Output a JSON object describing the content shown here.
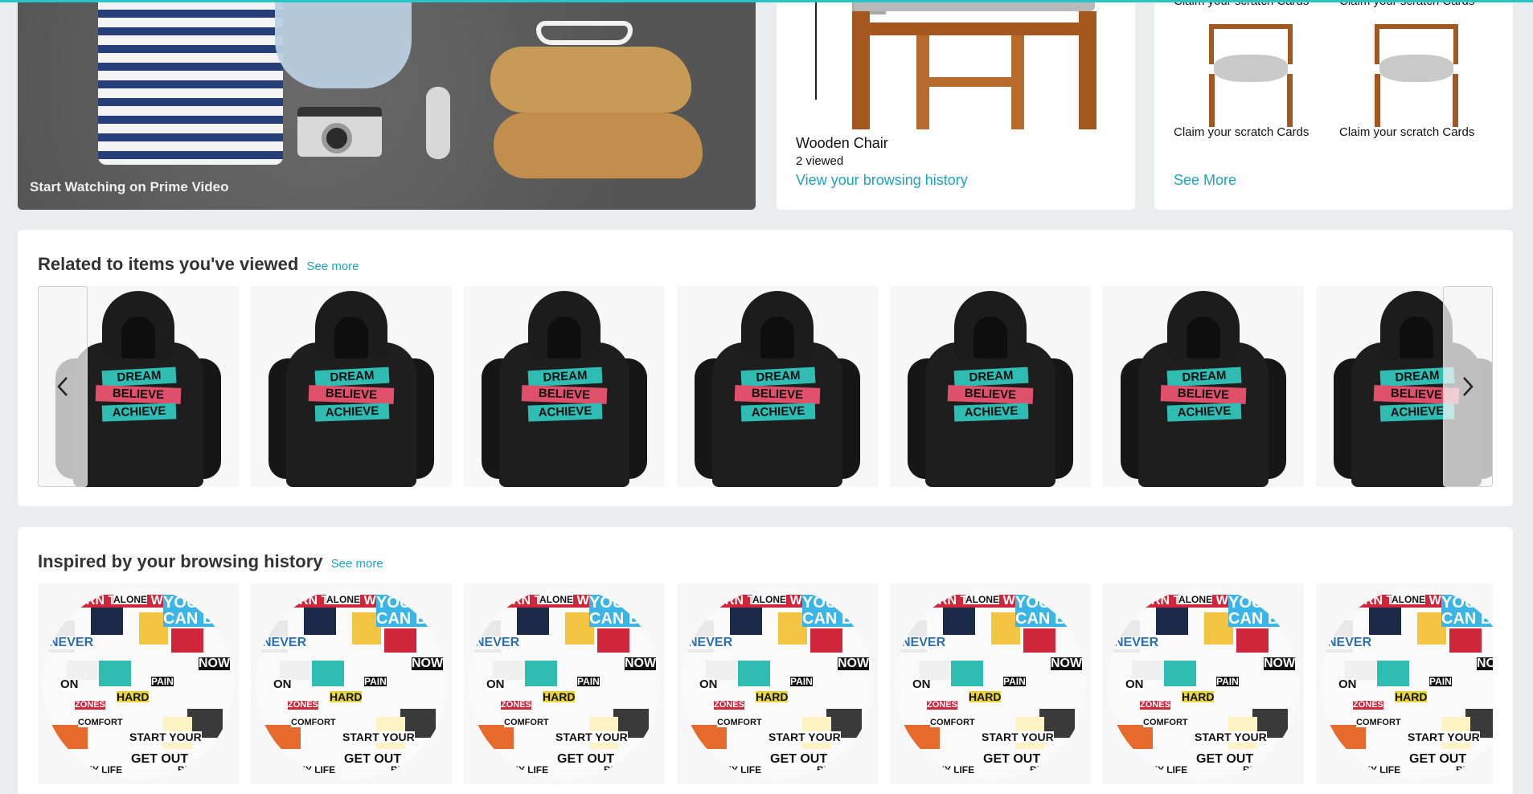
{
  "top_row": {
    "prime": {
      "label": "Start Watching on Prime Video"
    },
    "browsing": {
      "title": "Wooden Chair",
      "viewed": "2 viewed",
      "link": "View your browsing history"
    },
    "scratch": {
      "item_label": "Claim your scratch Cards",
      "see_more": "See More"
    }
  },
  "related": {
    "title": "Related to items you've viewed",
    "see_more": "See more",
    "items": [
      {
        "lines": [
          "DREAM",
          "BELIEVE",
          "ACHIEVE"
        ]
      },
      {
        "lines": [
          "DREAM",
          "BELIEVE",
          "ACHIEVE"
        ]
      },
      {
        "lines": [
          "DREAM",
          "BELIEVE",
          "ACHIEVE"
        ]
      },
      {
        "lines": [
          "DREAM",
          "BELIEVE",
          "ACHIEVE"
        ]
      },
      {
        "lines": [
          "DREAM",
          "BELIEVE",
          "ACHIEVE"
        ]
      },
      {
        "lines": [
          "DREAM",
          "BELIEVE",
          "ACHIEVE"
        ]
      },
      {
        "lines": [
          "DREAM",
          "BELIEVE",
          "ACHIEVE"
        ]
      }
    ]
  },
  "inspired": {
    "title": "Inspired by your browsing history",
    "see_more": "See more",
    "sticker_words": [
      "BORN TO BE WILD",
      "ALONE",
      "YOU CAN BE",
      "NEVER",
      "ON",
      "NOW",
      "HARD",
      "PAIN",
      "START YOUR",
      "GET OUT",
      "MY LIFE",
      "BED",
      "ZONES",
      "COMFORT"
    ]
  },
  "icons": {
    "prev": "chevron-left-icon",
    "next": "chevron-right-icon"
  },
  "colors": {
    "accent": "#1aa5c4",
    "top_line": "#26c6c6"
  }
}
